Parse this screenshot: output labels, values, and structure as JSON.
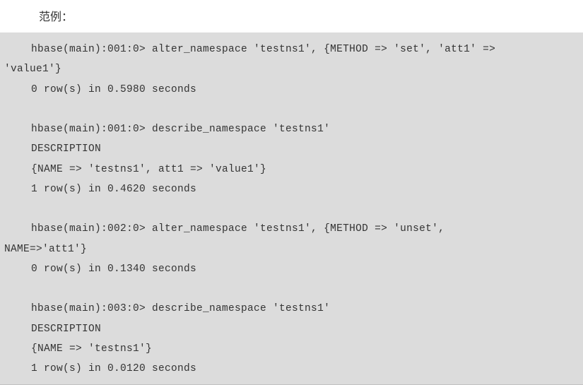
{
  "heading": "范例：",
  "code": {
    "l1": "hbase(main):001:0> alter_namespace 'testns1', {METHOD => 'set', 'att1' => ",
    "l2": "'value1'}",
    "l3": "0 row(s) in 0.5980 seconds",
    "l4": "hbase(main):001:0> describe_namespace 'testns1'",
    "l5": "DESCRIPTION",
    "l6": "{NAME => 'testns1', att1 => 'value1'}",
    "l7": "1 row(s) in 0.4620 seconds",
    "l8": "hbase(main):002:0> alter_namespace 'testns1', {METHOD => 'unset', ",
    "l9": "NAME=>'att1'}",
    "l10": "0 row(s) in 0.1340 seconds",
    "l11": "hbase(main):003:0> describe_namespace 'testns1'",
    "l12": "DESCRIPTION",
    "l13": "{NAME => 'testns1'}",
    "l14": "1 row(s) in 0.0120 seconds"
  }
}
